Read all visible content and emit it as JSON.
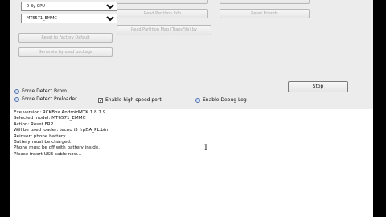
{
  "selects": {
    "cpu": "0-By CPU",
    "model": "MT6571_EMMC"
  },
  "buttons": {
    "reset_factory": "Reset to Factory Default",
    "generate_partition": "Generate by used package",
    "top_middle_1": "",
    "read_partition_info": "Read Partition Info",
    "read_partition_map": "Read Partition Map (TransFile) by",
    "top_right_1": "",
    "reset_friends": "Reset Friends",
    "stop": "Stop"
  },
  "options": {
    "force_detect_brom": "Force Detect Brom",
    "force_detect_preloader": "Force Detect Preloader",
    "high_speed_port": "Enable high speed port",
    "debug_log": "Enable Debug Log"
  },
  "log_lines": [
    "Exe version: RCKBox AndroidMTK 1.8.7.9",
    "Selected model: MT6571_EMMC",
    "Action: Reset FRP",
    "Will be used loader: tecno i3 frpDA_PL.bin",
    "Reinsert phone battery.",
    "Battery must be charged.",
    "Phone must be off with battery inside.",
    "Please insert USB cable now..."
  ],
  "cursor_glyph": "I"
}
